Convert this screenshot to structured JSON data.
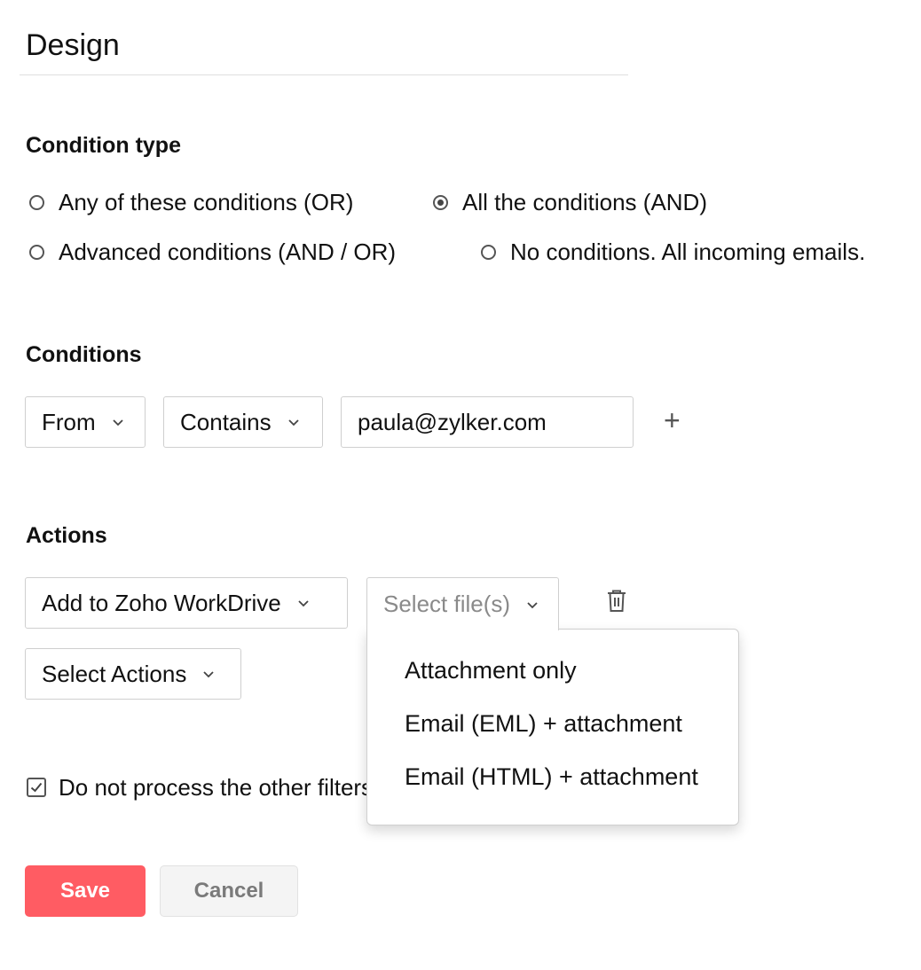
{
  "title": "Design",
  "condition_type": {
    "heading": "Condition type",
    "options": [
      {
        "label": "Any of these conditions (OR)",
        "selected": false
      },
      {
        "label": "All the conditions (AND)",
        "selected": true
      },
      {
        "label": "Advanced conditions (AND / OR)",
        "selected": false
      },
      {
        "label": "No conditions. All incoming emails.",
        "selected": false
      }
    ]
  },
  "conditions": {
    "heading": "Conditions",
    "field": "From",
    "operator": "Contains",
    "value": "paula@zylker.com",
    "add_icon": "plus-icon",
    "add_label": "+"
  },
  "actions": {
    "heading": "Actions",
    "action": "Add to Zoho WorkDrive",
    "file_select_placeholder": "Select file(s)",
    "delete_icon": "trash-icon",
    "select_actions": "Select Actions",
    "file_options": [
      "Attachment only",
      "Email (EML) + attachment",
      "Email (HTML) + attachment"
    ]
  },
  "options": {
    "stop_processing_label": "Do not process the other filters",
    "stop_processing_checked": true
  },
  "buttons": {
    "save": "Save",
    "cancel": "Cancel"
  },
  "colors": {
    "primary": "#ff5c63",
    "border": "#cfcfcf",
    "placeholder": "#8a8a8a"
  }
}
